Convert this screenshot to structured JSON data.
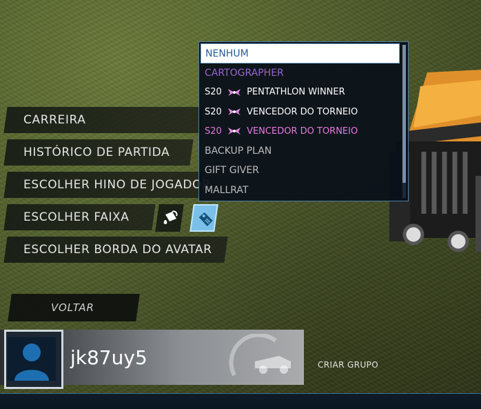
{
  "menu": {
    "items": [
      {
        "label": "CARREIRA"
      },
      {
        "label": "HISTÓRICO DE PARTIDA"
      },
      {
        "label": "ESCOLHER HINO DE JOGADOR"
      },
      {
        "label": "ESCOLHER FAIXA"
      },
      {
        "label": "ESCOLHER BORDA DO AVATAR"
      }
    ],
    "back_label": "VOLTAR",
    "icons": [
      "paint-bucket-icon",
      "tag-icon"
    ]
  },
  "title_dropdown": {
    "options": [
      {
        "text": "NENHUM",
        "style": "selected"
      },
      {
        "text": "CARTOGRAPHER",
        "style": "purple"
      },
      {
        "prefix": "S20",
        "text": "PENTATHLON WINNER",
        "style": "white",
        "icon": "wings-icon"
      },
      {
        "prefix": "S20",
        "text": "VENCEDOR DO TORNEIO",
        "style": "white",
        "icon": "wings-icon"
      },
      {
        "prefix": "S20",
        "text": "VENCEDOR DO TORNEIO",
        "style": "pink",
        "icon": "wings-icon"
      },
      {
        "text": "BACKUP PLAN",
        "style": "grey"
      },
      {
        "text": "GIFT GIVER",
        "style": "grey"
      },
      {
        "text": "MALLRAT",
        "style": "grey"
      }
    ]
  },
  "profile": {
    "username": "jk87uy5",
    "create_group_label": "CRIAR GRUPO"
  },
  "colors": {
    "accent": "#7ac0e8",
    "selected_text": "#2a5b9c",
    "purple": "#9a63d0",
    "pink": "#e47ae0"
  }
}
